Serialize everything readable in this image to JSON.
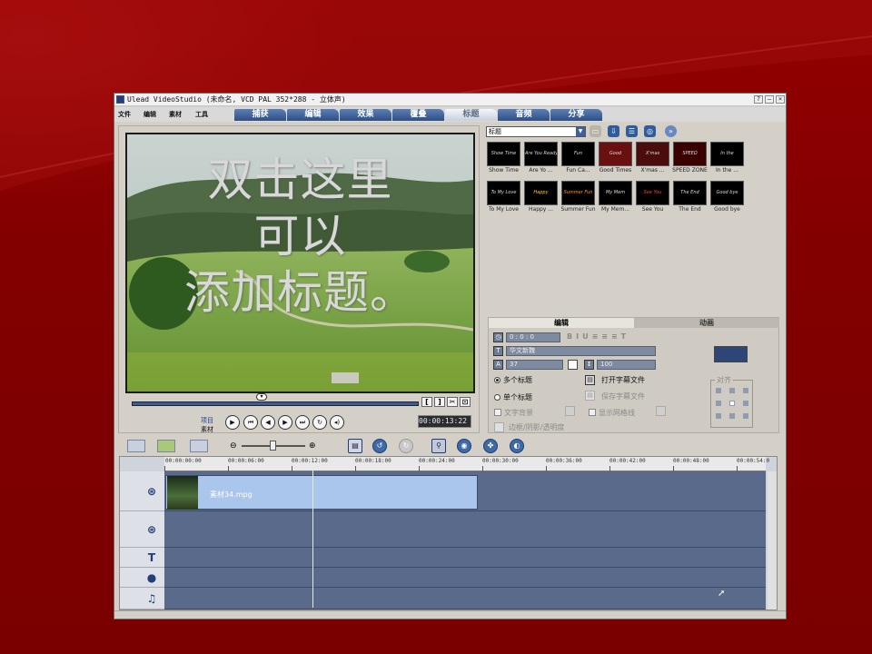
{
  "window": {
    "title": "Ulead VideoStudio (未命名, VCD PAL 352*288 - 立体声)",
    "buttons": [
      "?",
      "–",
      "×"
    ]
  },
  "menu": [
    "文件",
    "编辑",
    "素材",
    "工具"
  ],
  "tabs": [
    {
      "label": "捕获",
      "active": false
    },
    {
      "label": "编辑",
      "active": false
    },
    {
      "label": "效果",
      "active": false
    },
    {
      "label": "覆叠",
      "active": false
    },
    {
      "label": "标题",
      "active": true
    },
    {
      "label": "音频",
      "active": false
    },
    {
      "label": "分享",
      "active": false
    }
  ],
  "preview": {
    "overlay_lines": [
      "双击这里",
      "可以",
      "添加标题。"
    ],
    "mark_in": "[",
    "mark_out": "]",
    "mode_project": "项目",
    "mode_clip": "素材",
    "timecode": "00:00:13:22"
  },
  "library": {
    "category": "标题",
    "thumbnails": [
      {
        "label": "Show Time",
        "art": "Show Time"
      },
      {
        "label": "Are Yo ...",
        "art": "Are You Ready?"
      },
      {
        "label": "Fun Ca...",
        "art": "Fun"
      },
      {
        "label": "Good Times",
        "art": "Good"
      },
      {
        "label": "X'mas ...",
        "art": "X'mas"
      },
      {
        "label": "SPEED ZONE",
        "art": "SPEED"
      },
      {
        "label": "In the ...",
        "art": "In the"
      },
      {
        "label": "To My Love",
        "art": "To My Love"
      },
      {
        "label": "Happy ...",
        "art": "Happy"
      },
      {
        "label": "Summer Fun",
        "art": "Summer Fun"
      },
      {
        "label": "My Mem...",
        "art": "My Mem"
      },
      {
        "label": "See You",
        "art": "See You"
      },
      {
        "label": "The End",
        "art": "The End"
      },
      {
        "label": "Good bye",
        "art": "Good bye"
      }
    ]
  },
  "options": {
    "tab_edit": "编辑",
    "tab_animation": "动画",
    "duration": "0 : 0 : 0",
    "font": "华文新魏",
    "font_size": "37",
    "line_spacing": "100",
    "multi_title": "多个标题",
    "single_title": "单个标题",
    "open_subtitle": "打开字幕文件",
    "save_subtitle": "保存字幕文件",
    "text_background": "文字背景",
    "show_grid": "显示网格线",
    "border_shadow": "边框/阴影/透明度",
    "align": "对齐"
  },
  "timeline": {
    "ruler": [
      "00:00:00:00",
      "00:00:06:00",
      "00:00:12:00",
      "00:00:18:00",
      "00:00:24:00",
      "00:00:30:00",
      "00:00:36:00",
      "00:00:42:00",
      "00:00:48:00",
      "00:00:54:0"
    ],
    "clip_label": "素材34.mpg",
    "track_icons": [
      "video-track-icon",
      "overlay-track-icon",
      "title-track-icon",
      "voice-track-icon",
      "music-track-icon"
    ]
  },
  "colors": {
    "background": "#8a0000",
    "tab_active": "#f4f6fa",
    "tab": "#3b5b93",
    "track": "#5a6a8a",
    "clip": "#aac6ec"
  }
}
